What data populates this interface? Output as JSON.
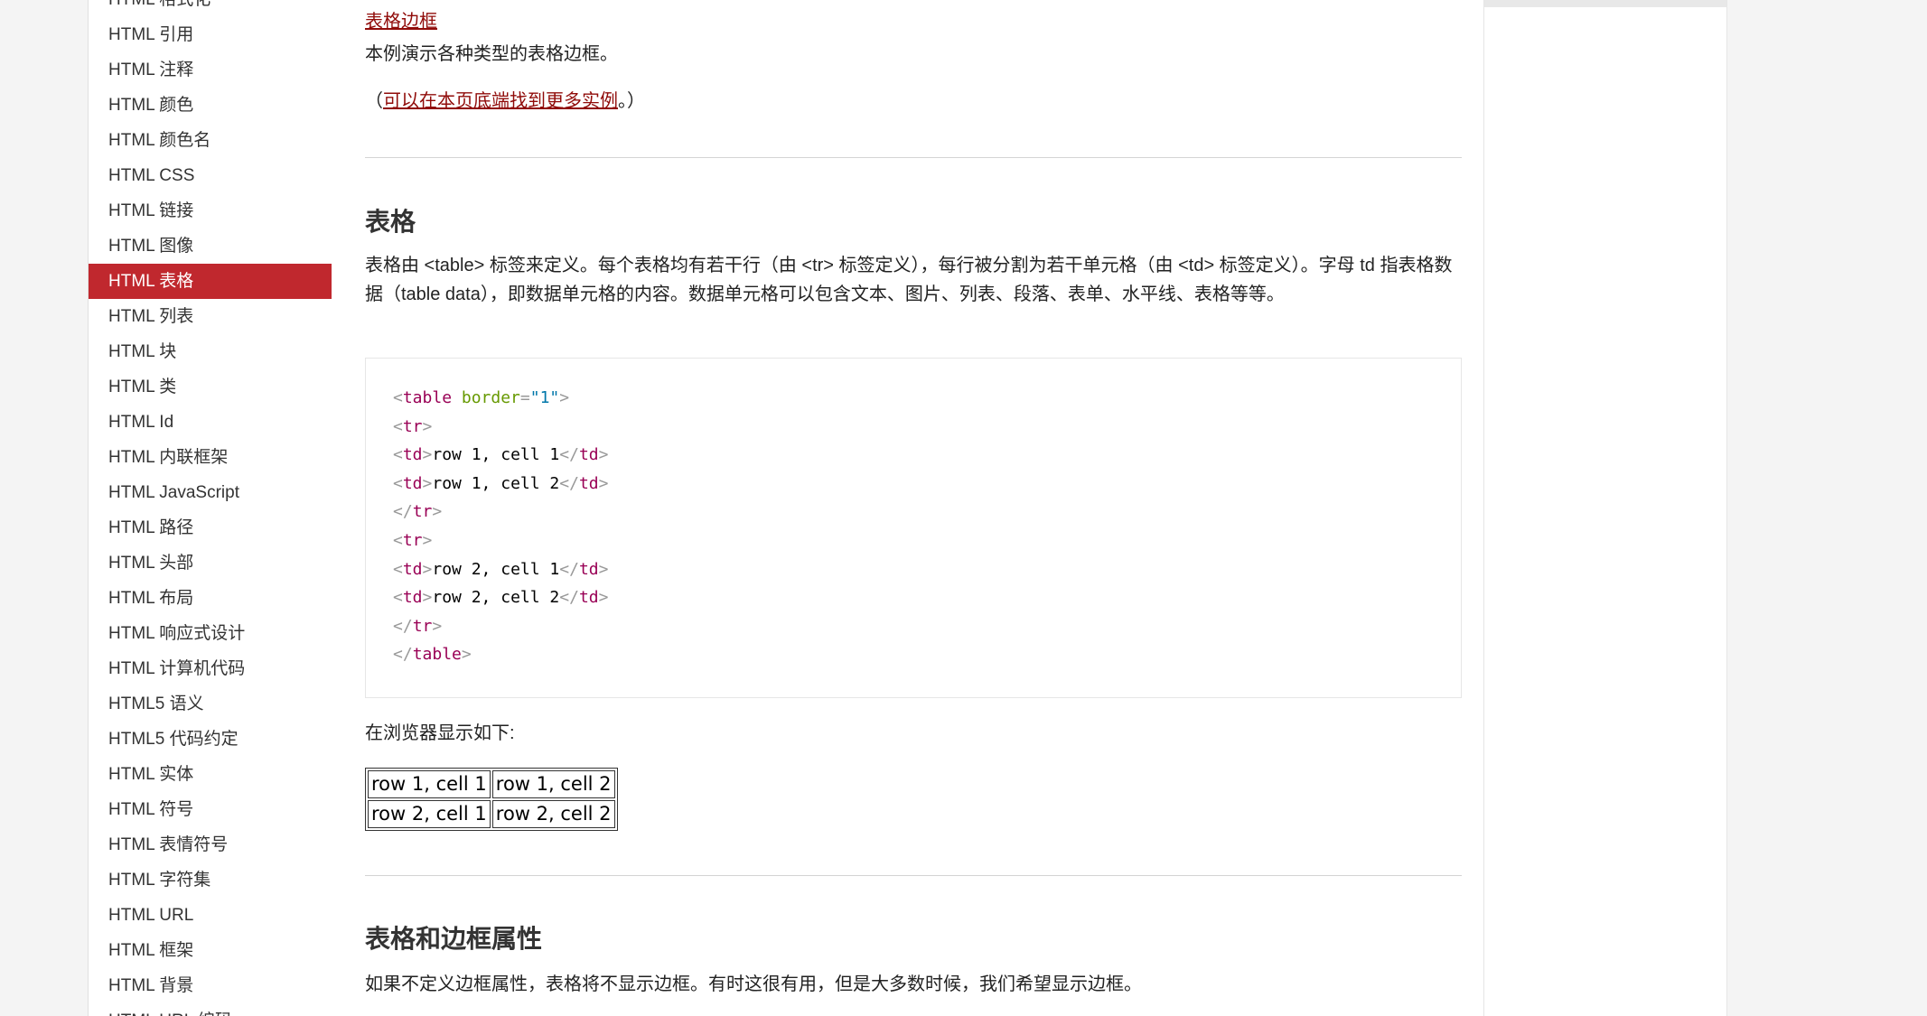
{
  "sidebar": {
    "items": [
      {
        "label": "HTML 格式化",
        "active": false
      },
      {
        "label": "HTML 引用",
        "active": false
      },
      {
        "label": "HTML 注释",
        "active": false
      },
      {
        "label": "HTML 颜色",
        "active": false
      },
      {
        "label": "HTML 颜色名",
        "active": false
      },
      {
        "label": "HTML CSS",
        "active": false
      },
      {
        "label": "HTML 链接",
        "active": false
      },
      {
        "label": "HTML 图像",
        "active": false
      },
      {
        "label": "HTML 表格",
        "active": true
      },
      {
        "label": "HTML 列表",
        "active": false
      },
      {
        "label": "HTML 块",
        "active": false
      },
      {
        "label": "HTML 类",
        "active": false
      },
      {
        "label": "HTML Id",
        "active": false
      },
      {
        "label": "HTML 内联框架",
        "active": false
      },
      {
        "label": "HTML JavaScript",
        "active": false
      },
      {
        "label": "HTML 路径",
        "active": false
      },
      {
        "label": "HTML 头部",
        "active": false
      },
      {
        "label": "HTML 布局",
        "active": false
      },
      {
        "label": "HTML 响应式设计",
        "active": false
      },
      {
        "label": "HTML 计算机代码",
        "active": false
      },
      {
        "label": "HTML5 语义",
        "active": false
      },
      {
        "label": "HTML5 代码约定",
        "active": false
      },
      {
        "label": "HTML 实体",
        "active": false
      },
      {
        "label": "HTML 符号",
        "active": false
      },
      {
        "label": "HTML 表情符号",
        "active": false
      },
      {
        "label": "HTML 字符集",
        "active": false
      },
      {
        "label": "HTML URL",
        "active": false
      },
      {
        "label": "HTML 框架",
        "active": false
      },
      {
        "label": "HTML 背景",
        "active": false
      },
      {
        "label": "HTML URL 编码",
        "active": false
      }
    ],
    "accent": "#c0282e"
  },
  "main": {
    "example_link": "表格边框",
    "example_desc": "本例演示各种类型的表格边框。",
    "more_prefix": "（",
    "more_link": "可以在本页底端找到更多实例",
    "more_suffix": "。）",
    "section1_title": "表格",
    "section1_text": "表格由 <table> 标签来定义。每个表格均有若干行（由 <tr> 标签定义），每行被分割为若干单元格（由 <td> 标签定义）。字母 td 指表格数据（table data），即数据单元格的内容。数据单元格可以包含文本、图片、列表、段落、表单、水平线、表格等等。",
    "code": {
      "open_table": "table",
      "attr_name": "border",
      "attr_eq": "=",
      "attr_value": "\"1\"",
      "tr": "tr",
      "td": "td",
      "table_close": "table",
      "lt": "<",
      "gt": ">",
      "lt_slash": "</",
      "r1c1": "row 1, cell 1",
      "r1c2": "row 1, cell 2",
      "r2c1": "row 2, cell 1",
      "r2c2": "row 2, cell 2"
    },
    "browser_label": "在浏览器显示如下:",
    "demo_table": [
      [
        "row 1, cell 1",
        "row 1, cell 2"
      ],
      [
        "row 2, cell 1",
        "row 2, cell 2"
      ]
    ],
    "section2_title": "表格和边框属性",
    "section2_text": "如果不定义边框属性，表格将不显示边框。有时这很有用，但是大多数时候，我们希望显示边框。"
  }
}
